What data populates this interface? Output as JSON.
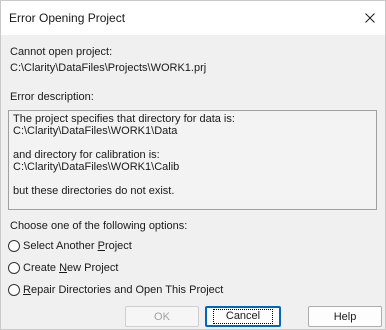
{
  "window": {
    "title": "Error Opening Project",
    "close_glyph": "✕"
  },
  "project": {
    "heading": "Cannot open project:",
    "path": "C:\\Clarity\\DataFiles\\Projects\\WORK1.prj"
  },
  "error": {
    "heading": "Error description:",
    "lines": [
      "The project specifies that directory for data is:",
      "C:\\Clarity\\DataFiles\\WORK1\\Data",
      "and directory for calibration is:",
      "C:\\Clarity\\DataFiles\\WORK1\\Calib",
      "but these directories do not exist."
    ]
  },
  "options": {
    "heading": "Choose one of the following options:",
    "items": [
      {
        "pre": "Select Another ",
        "key": "P",
        "post": "roject",
        "selected": false
      },
      {
        "pre": "Create ",
        "key": "N",
        "post": "ew Project",
        "selected": false
      },
      {
        "pre": "",
        "key": "R",
        "post": "epair Directories and Open This Project",
        "selected": false
      }
    ]
  },
  "buttons": {
    "ok": {
      "label": "OK",
      "enabled": false
    },
    "cancel": {
      "label": "Cancel",
      "enabled": true
    },
    "help": {
      "label": "Help",
      "enabled": true
    }
  }
}
